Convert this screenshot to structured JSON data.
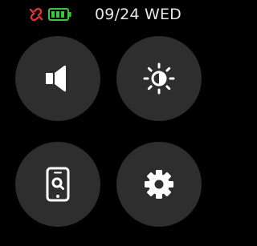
{
  "status_bar": {
    "datetime": "09/24 WED",
    "link_status_icon": "link-broken-icon",
    "battery_icon": "battery-icon",
    "battery_level": 1.0
  },
  "colors": {
    "background": "#000000",
    "tile": "#2e2e2e",
    "icon": "#ffffff",
    "link_broken": "#e0303a",
    "battery": "#36c93a",
    "datetime_text": "#e6e6e6"
  },
  "tiles": [
    {
      "id": "volume",
      "icon": "speaker-icon"
    },
    {
      "id": "brightness",
      "icon": "brightness-icon"
    },
    {
      "id": "find-phone",
      "icon": "phone-search-icon"
    },
    {
      "id": "settings",
      "icon": "gear-icon"
    }
  ]
}
